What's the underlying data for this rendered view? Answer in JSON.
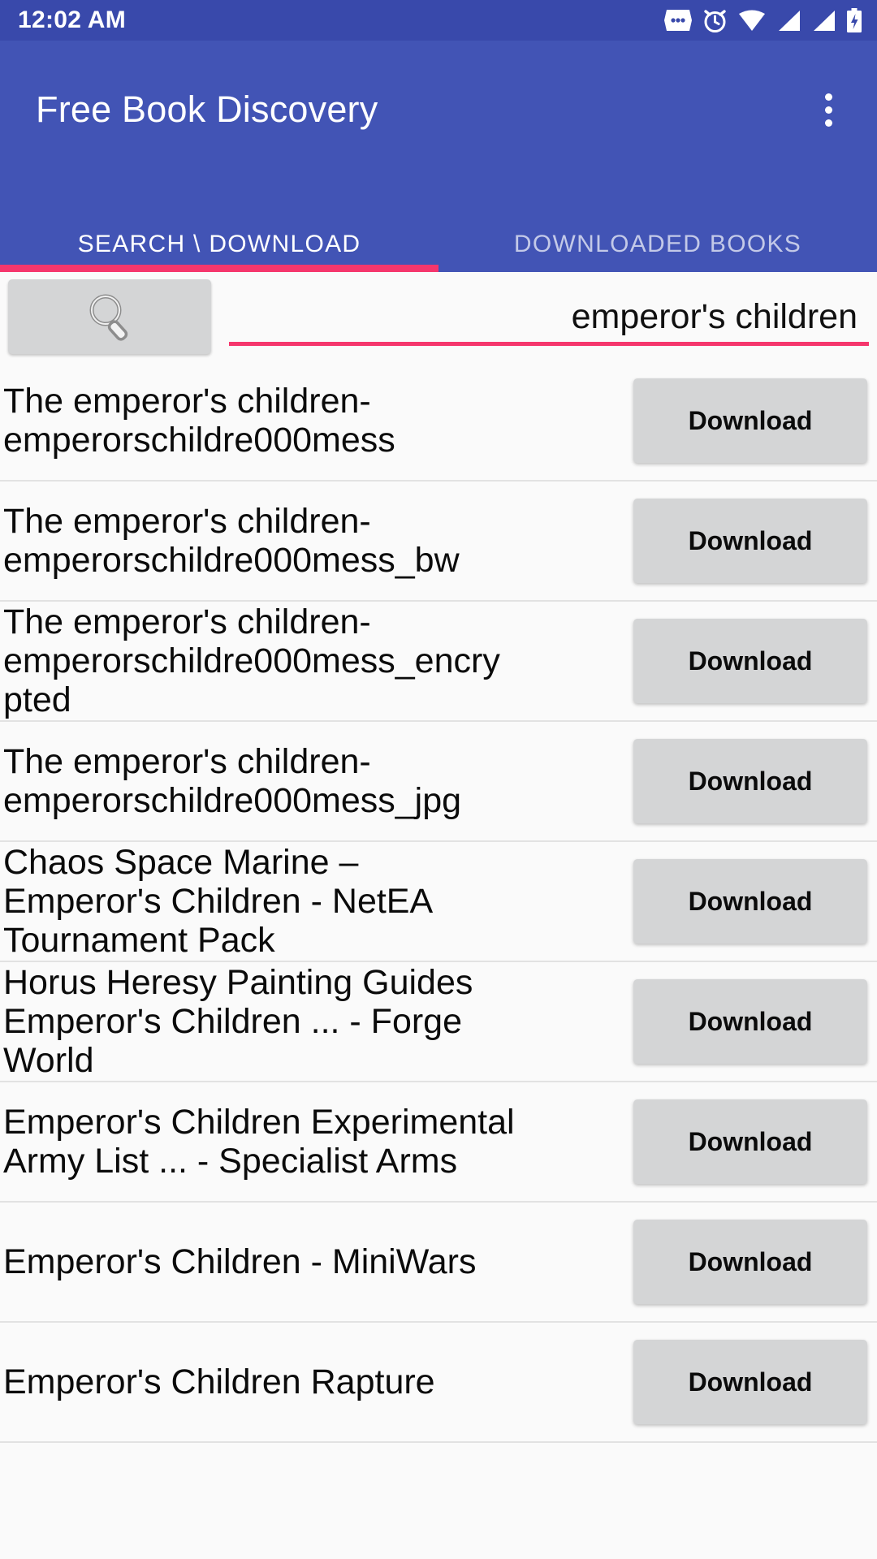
{
  "status_bar": {
    "time": "12:02 AM",
    "icons": [
      "messages-icon",
      "alarm-icon",
      "wifi-icon",
      "signal-icon",
      "signal-icon-2",
      "battery-charging-icon"
    ]
  },
  "app_bar": {
    "title": "Free Book Discovery",
    "overflow_menu": "overflow-menu-icon"
  },
  "tabs": [
    {
      "label": "SEARCH \\ DOWNLOAD",
      "active": true
    },
    {
      "label": "DOWNLOADED BOOKS",
      "active": false
    }
  ],
  "search": {
    "button_icon": "magnifier-icon",
    "value": "emperor's children",
    "placeholder": "Search"
  },
  "results": {
    "download_label": "Download",
    "items": [
      {
        "title": "The emperor's children-emperorschildre000mess"
      },
      {
        "title": "The emperor's children-emperorschildre000mess_bw"
      },
      {
        "title": "The emperor's children-emperorschildre000mess_encrypted"
      },
      {
        "title": "The emperor's children-emperorschildre000mess_jpg"
      },
      {
        "title": "Chaos Space Marine – Emperor's Children - NetEA Tournament Pack"
      },
      {
        "title": "Horus Heresy Painting Guides Emperor's Children ... - Forge World"
      },
      {
        "title": "Emperor's Children Experimental Army List ... - Specialist Arms"
      },
      {
        "title": "Emperor's Children - MiniWars"
      },
      {
        "title": "Emperor's Children Rapture"
      }
    ]
  },
  "colors": {
    "status_bar": "#3949ab",
    "app_bar": "#4254b5",
    "accent_pink": "#f5366c",
    "button_gray": "#d4d5d6",
    "page_bg": "#fafafa"
  }
}
